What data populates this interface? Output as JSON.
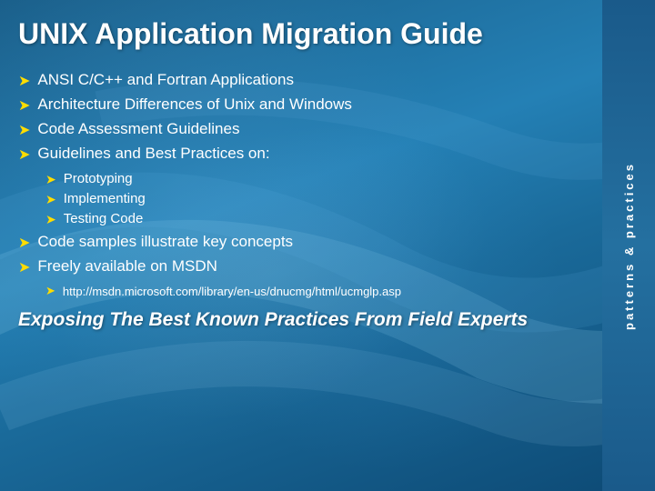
{
  "title": "UNIX Application Migration Guide",
  "right_banner": {
    "text": "patterns & practices"
  },
  "bullets": [
    {
      "text": "ANSI C/C++ and Fortran Applications"
    },
    {
      "text": "Architecture Differences of Unix and Windows"
    },
    {
      "text": "Code Assessment Guidelines"
    },
    {
      "text": "Guidelines and Best Practices on:",
      "sub_items": [
        {
          "text": "Prototyping"
        },
        {
          "text": "Implementing"
        },
        {
          "text": "Testing Code"
        }
      ]
    },
    {
      "text": "Code samples illustrate key concepts"
    },
    {
      "text": "Freely available on MSDN",
      "url": "http://msdn.microsoft.com/library/en-us/dnucmg/html/ucmglp.asp"
    }
  ],
  "tagline": "Exposing The Best Known Practices From Field Experts",
  "arrow_char": "➤"
}
